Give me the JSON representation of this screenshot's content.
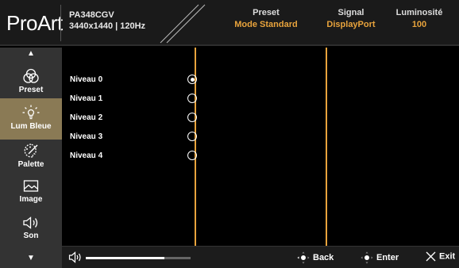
{
  "header": {
    "logo": "ProArt",
    "model": "PA348CGV",
    "resolution": "3440x1440 | 120Hz",
    "preset_label": "Preset",
    "preset_value": "Mode Standard",
    "signal_label": "Signal",
    "signal_value": "DisplayPort",
    "luminosity_label": "Luminosité",
    "luminosity_value": "100"
  },
  "sidebar": {
    "items": [
      {
        "label": "Preset",
        "icon": "preset-icon"
      },
      {
        "label": "Lum Bleue",
        "icon": "bulb-icon",
        "active": true
      },
      {
        "label": "Palette",
        "icon": "palette-icon"
      },
      {
        "label": "Image",
        "icon": "image-icon"
      },
      {
        "label": "Son",
        "icon": "speaker-icon"
      }
    ]
  },
  "options": [
    {
      "label": "Niveau 0",
      "selected": true
    },
    {
      "label": "Niveau 1",
      "selected": false
    },
    {
      "label": "Niveau 2",
      "selected": false
    },
    {
      "label": "Niveau 3",
      "selected": false
    },
    {
      "label": "Niveau 4",
      "selected": false
    }
  ],
  "footer": {
    "volume_level": 0.75,
    "back_label": "Back",
    "enter_label": "Enter",
    "exit_label": "Exit"
  },
  "colors": {
    "accent": "#e8a33c",
    "active_bg": "#8a7a55",
    "sidebar_bg": "#333333"
  }
}
